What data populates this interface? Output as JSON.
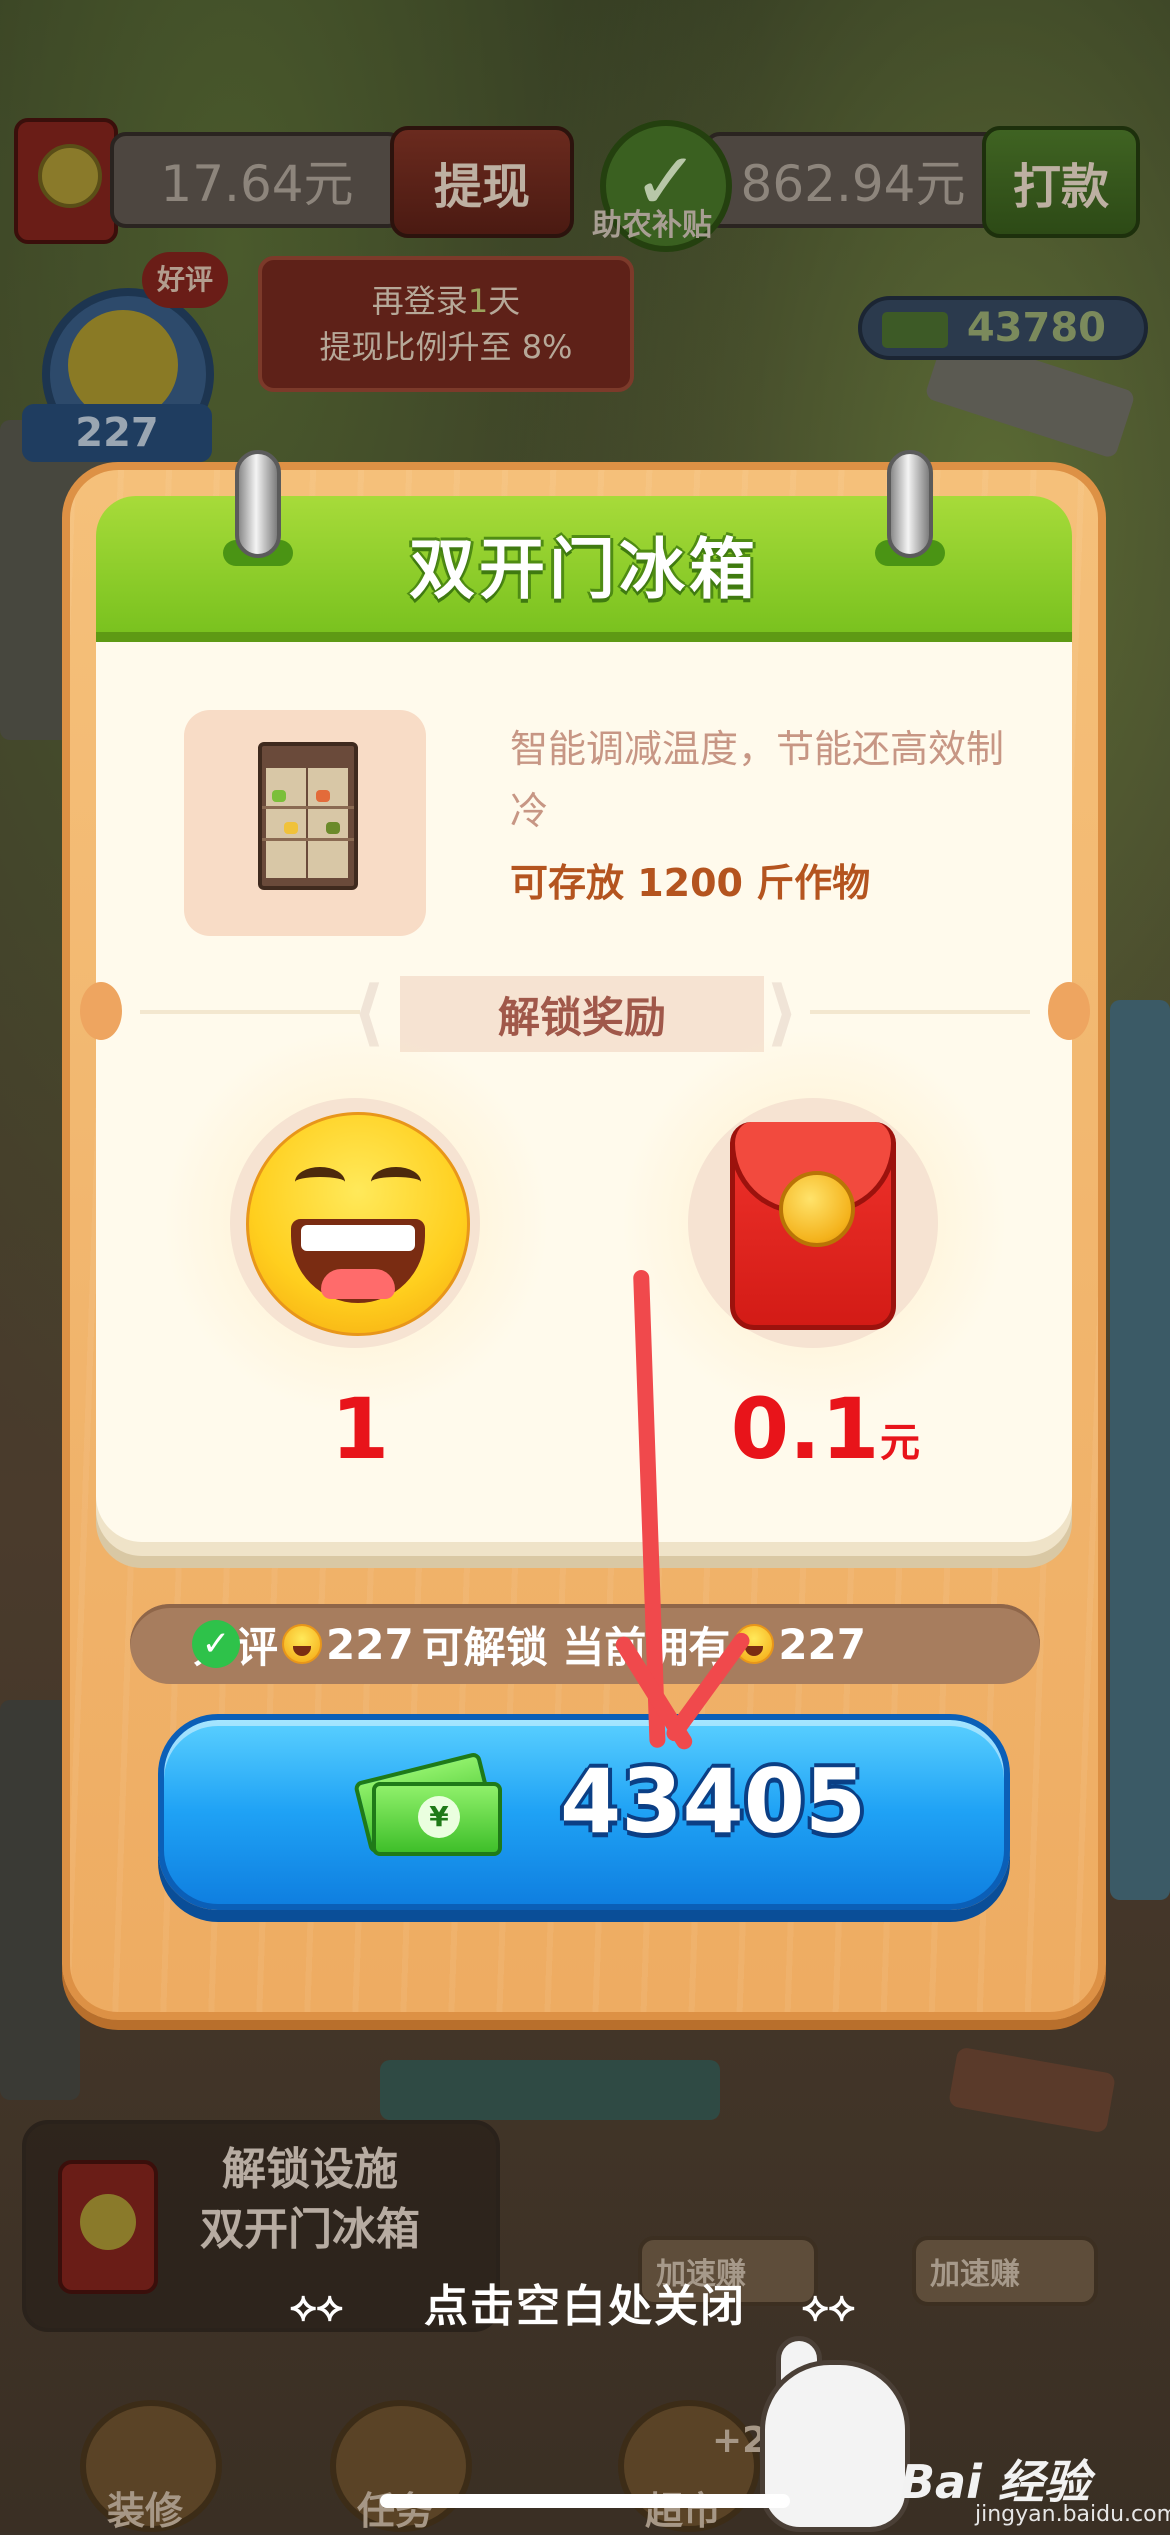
{
  "hud": {
    "balance": "17.64元",
    "withdraw_label": "提现",
    "subsidy_amount": "862.94元",
    "subsidy_label": "助农补贴",
    "transfer_label": "打款",
    "login_tip_line1_prefix": "再登录",
    "login_tip_line1_days": "1",
    "login_tip_line1_suffix": "天",
    "login_tip_line2": "提现比例升至 8%",
    "good_review_tag": "好评",
    "good_review_count": "227",
    "cash_count": "43780"
  },
  "modal": {
    "title": "双开门冰箱",
    "description": "智能调减温度，节能还高效制冷",
    "capacity": "可存放 1200 斤作物",
    "reward_section_title": "解锁奖励",
    "rewards": [
      {
        "icon": "grin-emoji-icon",
        "value": "1",
        "unit": ""
      },
      {
        "icon": "red-envelope-icon",
        "value": "0.1",
        "unit": "元"
      }
    ],
    "requirement": {
      "prefix": "好评",
      "need": "227",
      "middle": "可解锁 当前拥有",
      "have": "227"
    },
    "buy_price": "43405"
  },
  "background": {
    "unlock_line1": "解锁设施",
    "unlock_line2": "双开门冰箱",
    "speed_label": "加速赚",
    "nav": [
      "装修",
      "任务",
      "超市"
    ],
    "nav_badge": "+2"
  },
  "close_hint": "点击空白处关闭",
  "watermark": {
    "brand": "Bai 经验",
    "url": "jingyan.baidu.com"
  },
  "colors": {
    "header_green": "#8ccb2a",
    "reward_red": "#e8141a",
    "button_blue": "#1fa2f5",
    "arrow_red": "#f0494c"
  }
}
